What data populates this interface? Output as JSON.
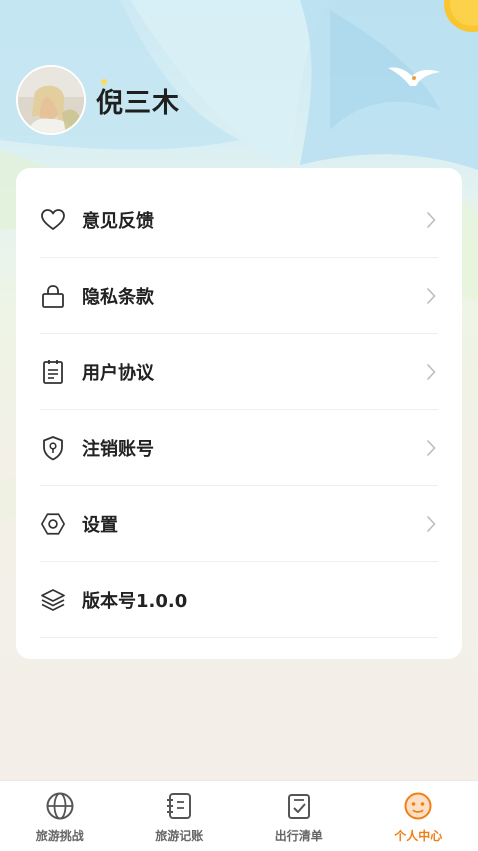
{
  "profile": {
    "name": "倪三木"
  },
  "menu": [
    {
      "icon": "heart-icon",
      "label": "意见反馈",
      "has_arrow": true
    },
    {
      "icon": "lock-icon",
      "label": "隐私条款",
      "has_arrow": true
    },
    {
      "icon": "document-icon",
      "label": "用户协议",
      "has_arrow": true
    },
    {
      "icon": "shield-icon",
      "label": "注销账号",
      "has_arrow": true
    },
    {
      "icon": "hexagon-icon",
      "label": "设置",
      "has_arrow": true
    },
    {
      "icon": "layers-icon",
      "label": "版本号1.0.0",
      "has_arrow": false
    }
  ],
  "tabbar": [
    {
      "icon": "globe-icon",
      "label": "旅游挑战",
      "active": false
    },
    {
      "icon": "notebook-icon",
      "label": "旅游记账",
      "active": false
    },
    {
      "icon": "checklist-icon",
      "label": "出行清单",
      "active": false
    },
    {
      "icon": "smiley-icon",
      "label": "个人中心",
      "active": true
    }
  ],
  "colors": {
    "accent": "#f07f16",
    "text": "#222222",
    "inactive": "#666666"
  }
}
